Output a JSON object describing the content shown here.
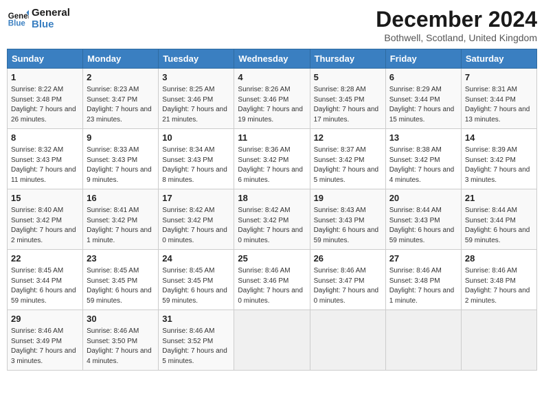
{
  "logo": {
    "line1": "General",
    "line2": "Blue"
  },
  "title": "December 2024",
  "location": "Bothwell, Scotland, United Kingdom",
  "days_of_week": [
    "Sunday",
    "Monday",
    "Tuesday",
    "Wednesday",
    "Thursday",
    "Friday",
    "Saturday"
  ],
  "weeks": [
    [
      {
        "day": 1,
        "sunrise": "8:22 AM",
        "sunset": "3:48 PM",
        "daylight": "7 hours and 26 minutes."
      },
      {
        "day": 2,
        "sunrise": "8:23 AM",
        "sunset": "3:47 PM",
        "daylight": "7 hours and 23 minutes."
      },
      {
        "day": 3,
        "sunrise": "8:25 AM",
        "sunset": "3:46 PM",
        "daylight": "7 hours and 21 minutes."
      },
      {
        "day": 4,
        "sunrise": "8:26 AM",
        "sunset": "3:46 PM",
        "daylight": "7 hours and 19 minutes."
      },
      {
        "day": 5,
        "sunrise": "8:28 AM",
        "sunset": "3:45 PM",
        "daylight": "7 hours and 17 minutes."
      },
      {
        "day": 6,
        "sunrise": "8:29 AM",
        "sunset": "3:44 PM",
        "daylight": "7 hours and 15 minutes."
      },
      {
        "day": 7,
        "sunrise": "8:31 AM",
        "sunset": "3:44 PM",
        "daylight": "7 hours and 13 minutes."
      }
    ],
    [
      {
        "day": 8,
        "sunrise": "8:32 AM",
        "sunset": "3:43 PM",
        "daylight": "7 hours and 11 minutes."
      },
      {
        "day": 9,
        "sunrise": "8:33 AM",
        "sunset": "3:43 PM",
        "daylight": "7 hours and 9 minutes."
      },
      {
        "day": 10,
        "sunrise": "8:34 AM",
        "sunset": "3:43 PM",
        "daylight": "7 hours and 8 minutes."
      },
      {
        "day": 11,
        "sunrise": "8:36 AM",
        "sunset": "3:42 PM",
        "daylight": "7 hours and 6 minutes."
      },
      {
        "day": 12,
        "sunrise": "8:37 AM",
        "sunset": "3:42 PM",
        "daylight": "7 hours and 5 minutes."
      },
      {
        "day": 13,
        "sunrise": "8:38 AM",
        "sunset": "3:42 PM",
        "daylight": "7 hours and 4 minutes."
      },
      {
        "day": 14,
        "sunrise": "8:39 AM",
        "sunset": "3:42 PM",
        "daylight": "7 hours and 3 minutes."
      }
    ],
    [
      {
        "day": 15,
        "sunrise": "8:40 AM",
        "sunset": "3:42 PM",
        "daylight": "7 hours and 2 minutes."
      },
      {
        "day": 16,
        "sunrise": "8:41 AM",
        "sunset": "3:42 PM",
        "daylight": "7 hours and 1 minute."
      },
      {
        "day": 17,
        "sunrise": "8:42 AM",
        "sunset": "3:42 PM",
        "daylight": "7 hours and 0 minutes."
      },
      {
        "day": 18,
        "sunrise": "8:42 AM",
        "sunset": "3:42 PM",
        "daylight": "7 hours and 0 minutes."
      },
      {
        "day": 19,
        "sunrise": "8:43 AM",
        "sunset": "3:43 PM",
        "daylight": "6 hours and 59 minutes."
      },
      {
        "day": 20,
        "sunrise": "8:44 AM",
        "sunset": "3:43 PM",
        "daylight": "6 hours and 59 minutes."
      },
      {
        "day": 21,
        "sunrise": "8:44 AM",
        "sunset": "3:44 PM",
        "daylight": "6 hours and 59 minutes."
      }
    ],
    [
      {
        "day": 22,
        "sunrise": "8:45 AM",
        "sunset": "3:44 PM",
        "daylight": "6 hours and 59 minutes."
      },
      {
        "day": 23,
        "sunrise": "8:45 AM",
        "sunset": "3:45 PM",
        "daylight": "6 hours and 59 minutes."
      },
      {
        "day": 24,
        "sunrise": "8:45 AM",
        "sunset": "3:45 PM",
        "daylight": "6 hours and 59 minutes."
      },
      {
        "day": 25,
        "sunrise": "8:46 AM",
        "sunset": "3:46 PM",
        "daylight": "7 hours and 0 minutes."
      },
      {
        "day": 26,
        "sunrise": "8:46 AM",
        "sunset": "3:47 PM",
        "daylight": "7 hours and 0 minutes."
      },
      {
        "day": 27,
        "sunrise": "8:46 AM",
        "sunset": "3:48 PM",
        "daylight": "7 hours and 1 minute."
      },
      {
        "day": 28,
        "sunrise": "8:46 AM",
        "sunset": "3:48 PM",
        "daylight": "7 hours and 2 minutes."
      }
    ],
    [
      {
        "day": 29,
        "sunrise": "8:46 AM",
        "sunset": "3:49 PM",
        "daylight": "7 hours and 3 minutes."
      },
      {
        "day": 30,
        "sunrise": "8:46 AM",
        "sunset": "3:50 PM",
        "daylight": "7 hours and 4 minutes."
      },
      {
        "day": 31,
        "sunrise": "8:46 AM",
        "sunset": "3:52 PM",
        "daylight": "7 hours and 5 minutes."
      },
      null,
      null,
      null,
      null
    ]
  ]
}
